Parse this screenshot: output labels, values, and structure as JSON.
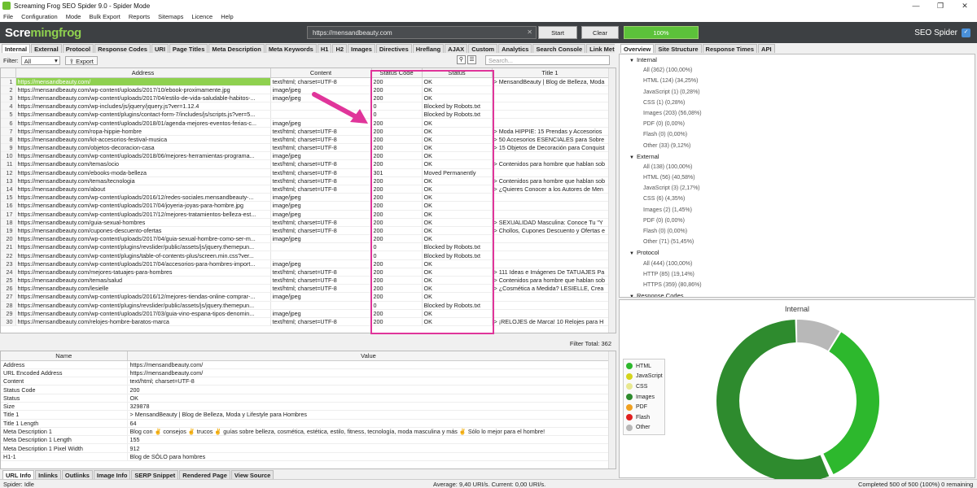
{
  "window": {
    "title": "Screaming Frog SEO Spider 9.0 - Spider Mode"
  },
  "menu": [
    "File",
    "Configuration",
    "Mode",
    "Bulk Export",
    "Reports",
    "Sitemaps",
    "Licence",
    "Help"
  ],
  "toolbar": {
    "logo_a": "Scre",
    "logo_b": "mingfrog",
    "url": "https://mensandbeauty.com",
    "start": "Start",
    "clear": "Clear",
    "progress": "100%",
    "progress_fraction": 1.0,
    "brand": "SEO Spider"
  },
  "tabs": [
    "Internal",
    "External",
    "Protocol",
    "Response Codes",
    "URI",
    "Page Titles",
    "Meta Description",
    "Meta Keywords",
    "H1",
    "H2",
    "Images",
    "Directives",
    "Hreflang",
    "AJAX",
    "Custom",
    "Analytics",
    "Search Console",
    "Link Metr"
  ],
  "filter": {
    "label": "Filter:",
    "value": "All",
    "export": "Export",
    "search_placeholder": "Search..."
  },
  "grid": {
    "headers": [
      "",
      "Address",
      "Content",
      "Status Code",
      "Status",
      "Title 1"
    ],
    "rows": [
      [
        "1",
        "https://mensandbeauty.com/",
        "text/html; charset=UTF-8",
        "200",
        "OK",
        "> MensandBeauty | Blog de Belleza, Moda"
      ],
      [
        "2",
        "https://mensandbeauty.com/wp-content/uploads/2017/10/ebook-proximamente.jpg",
        "image/jpeg",
        "200",
        "OK",
        ""
      ],
      [
        "3",
        "https://mensandbeauty.com/wp-content/uploads/2017/04/estilo-de-vida-saludable-habitos-...",
        "image/jpeg",
        "200",
        "OK",
        ""
      ],
      [
        "4",
        "https://mensandbeauty.com/wp-includes/js/jquery/jquery.js?ver=1.12.4",
        "",
        "0",
        "Blocked by Robots.txt",
        ""
      ],
      [
        "5",
        "https://mensandbeauty.com/wp-content/plugins/contact-form-7/includes/js/scripts.js?ver=5...",
        "",
        "0",
        "Blocked by Robots.txt",
        ""
      ],
      [
        "6",
        "https://mensandbeauty.com/wp-content/uploads/2018/01/agenda-mejores-eventos-ferias-c...",
        "image/jpeg",
        "200",
        "OK",
        ""
      ],
      [
        "7",
        "https://mensandbeauty.com/ropa-hippie-hombre",
        "text/html; charset=UTF-8",
        "200",
        "OK",
        "> Moda HIPPIE: 15 Prendas y Accesorios"
      ],
      [
        "8",
        "https://mensandbeauty.com/kit-accesorios-festival-musica",
        "text/html; charset=UTF-8",
        "200",
        "OK",
        "> 50 Accesorios ESENCIALES para Sobre"
      ],
      [
        "9",
        "https://mensandbeauty.com/objetos-decoracion-casa",
        "text/html; charset=UTF-8",
        "200",
        "OK",
        "> 15 Objetos de Decoración para Conquist"
      ],
      [
        "10",
        "https://mensandbeauty.com/wp-content/uploads/2018/06/mejores-herramientas-programa...",
        "image/jpeg",
        "200",
        "OK",
        ""
      ],
      [
        "11",
        "https://mensandbeauty.com/temas/ocio",
        "text/html; charset=UTF-8",
        "200",
        "OK",
        "> Contenidos para hombre que hablan sob"
      ],
      [
        "12",
        "https://mensandbeauty.com/ebooks-moda-belleza",
        "text/html; charset=UTF-8",
        "301",
        "Moved Permanently",
        ""
      ],
      [
        "13",
        "https://mensandbeauty.com/temas/tecnologia",
        "text/html; charset=UTF-8",
        "200",
        "OK",
        "> Contenidos para hombre que hablan sob"
      ],
      [
        "14",
        "https://mensandbeauty.com/about",
        "text/html; charset=UTF-8",
        "200",
        "OK",
        "> ¿Quieres Conocer a los Autores de Men"
      ],
      [
        "15",
        "https://mensandbeauty.com/wp-content/uploads/2016/12/redes-sociales.mensandbeauty-...",
        "image/jpeg",
        "200",
        "OK",
        ""
      ],
      [
        "16",
        "https://mensandbeauty.com/wp-content/uploads/2017/04/joyeria-joyas-para-hombre.jpg",
        "image/jpeg",
        "200",
        "OK",
        ""
      ],
      [
        "17",
        "https://mensandbeauty.com/wp-content/uploads/2017/12/mejores-tratamientos-belleza-est...",
        "image/jpeg",
        "200",
        "OK",
        ""
      ],
      [
        "18",
        "https://mensandbeauty.com/guia-sexual-hombres",
        "text/html; charset=UTF-8",
        "200",
        "OK",
        "> SEXUALIDAD Masculina: Conoce Tu \"Y"
      ],
      [
        "19",
        "https://mensandbeauty.com/cupones-descuento-ofertas",
        "text/html; charset=UTF-8",
        "200",
        "OK",
        "> Chollos, Cupones Descuento y Ofertas e"
      ],
      [
        "20",
        "https://mensandbeauty.com/wp-content/uploads/2017/04/guia-sexual-hombre-como-ser-m...",
        "image/jpeg",
        "200",
        "OK",
        ""
      ],
      [
        "21",
        "https://mensandbeauty.com/wp-content/plugins/revslider/public/assets/js/jquery.themepun...",
        "",
        "0",
        "Blocked by Robots.txt",
        ""
      ],
      [
        "22",
        "https://mensandbeauty.com/wp-content/plugins/table-of-contents-plus/screen.min.css?ver...",
        "",
        "0",
        "Blocked by Robots.txt",
        ""
      ],
      [
        "23",
        "https://mensandbeauty.com/wp-content/uploads/2017/04/accesorios-para-hombres-import...",
        "image/jpeg",
        "200",
        "OK",
        ""
      ],
      [
        "24",
        "https://mensandbeauty.com/mejores-tatuajes-para-hombres",
        "text/html; charset=UTF-8",
        "200",
        "OK",
        "> 111 Ideas e Imágenes De TATUAJES Pa"
      ],
      [
        "25",
        "https://mensandbeauty.com/temas/salud",
        "text/html; charset=UTF-8",
        "200",
        "OK",
        "> Contenidos para hombre que hablan sob"
      ],
      [
        "26",
        "https://mensandbeauty.com/lesielle",
        "text/html; charset=UTF-8",
        "200",
        "OK",
        "> ¿Cosmética a Medida? LESIELLE, Crea"
      ],
      [
        "27",
        "https://mensandbeauty.com/wp-content/uploads/2016/12/mejores-tiendas-online-comprar-...",
        "image/jpeg",
        "200",
        "OK",
        ""
      ],
      [
        "28",
        "https://mensandbeauty.com/wp-content/plugins/revslider/public/assets/js/jquery.themepun...",
        "",
        "0",
        "Blocked by Robots.txt",
        ""
      ],
      [
        "29",
        "https://mensandbeauty.com/wp-content/uploads/2017/03/guia-vino-espana-tipos-denomin...",
        "image/jpeg",
        "200",
        "OK",
        ""
      ],
      [
        "30",
        "https://mensandbeauty.com/relojes-hombre-baratos-marca",
        "text/html; charset=UTF-8",
        "200",
        "OK",
        "> ¡RELOJES de Marca! 10 Relojes para H"
      ]
    ],
    "filter_total_label": "Filter Total:",
    "filter_total": "362"
  },
  "detail": {
    "headers": [
      "Name",
      "Value"
    ],
    "rows": [
      [
        "Address",
        "https://mensandbeauty.com/"
      ],
      [
        "URL Encoded Address",
        "https://mensandbeauty.com/"
      ],
      [
        "Content",
        "text/html; charset=UTF-8"
      ],
      [
        "Status Code",
        "200"
      ],
      [
        "Status",
        "OK"
      ],
      [
        "Size",
        "329878"
      ],
      [
        "Title 1",
        "> MensandBeauty | Blog de Belleza, Moda y Lifestyle para Hombres"
      ],
      [
        "Title 1 Length",
        "64"
      ],
      [
        "Meta Description 1",
        "Blog con ✌ consejos ✌ trucos ✌ guías sobre belleza, cosmética, estética, estilo, fitness, tecnología, moda masculina y más ✌ Sólo lo mejor para el hombre!"
      ],
      [
        "Meta Description 1 Length",
        "155"
      ],
      [
        "Meta Description 1 Pixel Width",
        "912"
      ],
      [
        "H1-1",
        "Blog de SÓLO para hombres"
      ]
    ]
  },
  "bottom_tabs": [
    "URL Info",
    "Inlinks",
    "Outlinks",
    "Image Info",
    "SERP Snippet",
    "Rendered Page",
    "View Source"
  ],
  "status": {
    "left": "Spider: Idle",
    "center": "Average: 9,40 URI/s. Current: 0,00 URI/s.",
    "right": "Completed 500 of 500 (100%) 0 remaining"
  },
  "right_tabs": [
    "Overview",
    "Site Structure",
    "Response Times",
    "API"
  ],
  "tree": [
    {
      "group": "Internal",
      "items": [
        "All (362) (100,00%)",
        "HTML (124) (34,25%)",
        "JavaScript (1) (0,28%)",
        "CSS (1) (0,28%)",
        "Images (203) (56,08%)",
        "PDF (0) (0,00%)",
        "Flash (0) (0,00%)",
        "Other (33) (9,12%)"
      ]
    },
    {
      "group": "External",
      "items": [
        "All (138) (100,00%)",
        "HTML (56) (40,58%)",
        "JavaScript (3) (2,17%)",
        "CSS (6) (4,35%)",
        "Images (2) (1,45%)",
        "PDF (0) (0,00%)",
        "Flash (0) (0,00%)",
        "Other (71) (51,45%)"
      ]
    },
    {
      "group": "Protocol",
      "items": [
        "All (444) (100,00%)",
        "HTTP (85) (19,14%)",
        "HTTPS (359) (80,86%)"
      ]
    },
    {
      "group": "Response Codes",
      "items": []
    }
  ],
  "chart_data": {
    "type": "pie",
    "title": "Internal",
    "series": [
      {
        "name": "HTML",
        "value": 124,
        "color": "#2db82d"
      },
      {
        "name": "JavaScript",
        "value": 1,
        "color": "#d4d41c"
      },
      {
        "name": "CSS",
        "value": 1,
        "color": "#e8e890"
      },
      {
        "name": "Images",
        "value": 203,
        "color": "#2e8b2e"
      },
      {
        "name": "PDF",
        "value": 0,
        "color": "#f0a020"
      },
      {
        "name": "Flash",
        "value": 0,
        "color": "#e02020"
      },
      {
        "name": "Other",
        "value": 33,
        "color": "#b8b8b8"
      }
    ]
  },
  "colors": {
    "highlight": "#e0359a",
    "accent": "#8fd14f"
  }
}
